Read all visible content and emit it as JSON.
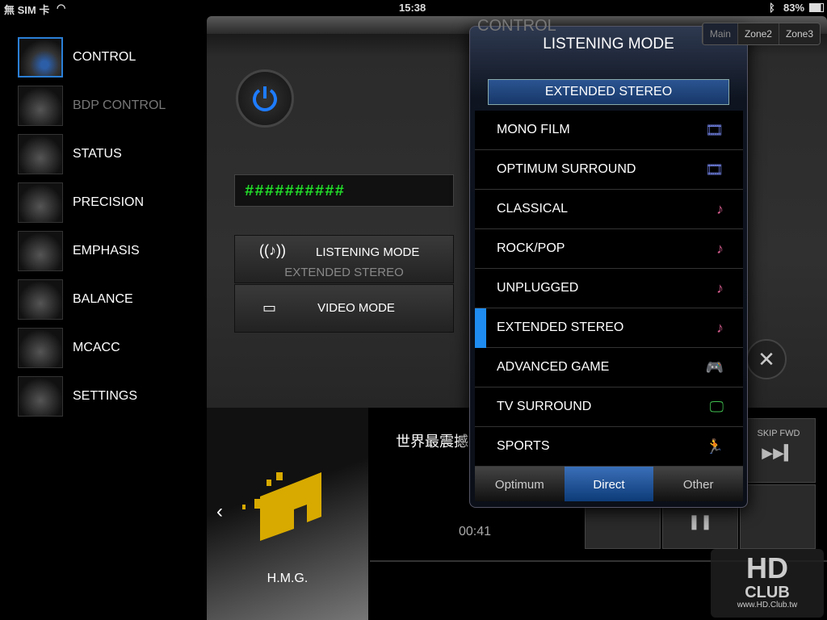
{
  "status": {
    "carrier": "無 SIM 卡",
    "time": "15:38",
    "battery": "83%"
  },
  "sidebar": {
    "items": [
      {
        "label": "CONTROL",
        "active": true
      },
      {
        "label": "BDP CONTROL",
        "dim": true
      },
      {
        "label": "STATUS"
      },
      {
        "label": "PRECISION"
      },
      {
        "label": "EMPHASIS"
      },
      {
        "label": "BALANCE"
      },
      {
        "label": "MCACC"
      },
      {
        "label": "SETTINGS"
      }
    ]
  },
  "header": {
    "title": "CONTROL",
    "zones": [
      "Main",
      "Zone2",
      "Zone3"
    ]
  },
  "main": {
    "display": "##########",
    "listening_label": "LISTENING MODE",
    "listening_value": "EXTENDED STEREO",
    "video_label": "VIDEO MODE"
  },
  "player": {
    "track": "世界最震撼",
    "time": "00:41",
    "artist": "H.M.G.",
    "skip_fwd": "SKIP FWD"
  },
  "popup": {
    "title": "LISTENING MODE",
    "selected": "EXTENDED STEREO",
    "items": [
      {
        "label": "MONO FILM",
        "icon": "film-icon",
        "color": "#6f7fe0"
      },
      {
        "label": "OPTIMUM SURROUND",
        "icon": "film-icon",
        "color": "#6f7fe0"
      },
      {
        "label": "CLASSICAL",
        "icon": "music-note-icon",
        "color": "#d05a8a"
      },
      {
        "label": "ROCK/POP",
        "icon": "music-note-icon",
        "color": "#d05a8a"
      },
      {
        "label": "UNPLUGGED",
        "icon": "music-note-icon",
        "color": "#d05a8a"
      },
      {
        "label": "EXTENDED STEREO",
        "icon": "music-note-icon",
        "color": "#d05a8a",
        "current": true
      },
      {
        "label": "ADVANCED GAME",
        "icon": "gamepad-icon",
        "color": "#d8d040"
      },
      {
        "label": "TV SURROUND",
        "icon": "tv-icon",
        "color": "#3fbf4f"
      },
      {
        "label": "SPORTS",
        "icon": "runner-icon",
        "color": "#e07050"
      }
    ],
    "tabs": [
      {
        "label": "Optimum"
      },
      {
        "label": "Direct",
        "active": true
      },
      {
        "label": "Other"
      }
    ]
  },
  "watermark": {
    "text": "HD CLUB",
    "url": "www.HD.Club.tw"
  },
  "colors": {
    "accent": "#1e8cf0",
    "display_green": "#22e02a",
    "album_yellow": "#d8aa00"
  }
}
